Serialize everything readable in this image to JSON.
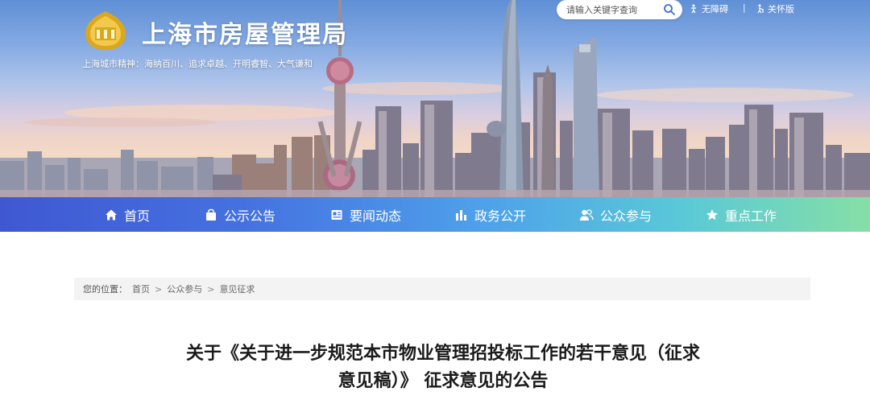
{
  "header": {
    "site_title": "上海市房屋管理局",
    "slogan": "上海城市精神：海纳百川、追求卓越、开明睿智、大气谦和",
    "logo_text": "Ⅲ"
  },
  "search": {
    "placeholder": "请输入关键字查询"
  },
  "top_links": {
    "accessibility": "无障碍",
    "elderly": "关怀版"
  },
  "nav": {
    "items": [
      {
        "label": "首页",
        "icon": "home-icon"
      },
      {
        "label": "公示公告",
        "icon": "bag-icon"
      },
      {
        "label": "要闻动态",
        "icon": "news-icon"
      },
      {
        "label": "政务公开",
        "icon": "bar-chart-icon"
      },
      {
        "label": "公众参与",
        "icon": "users-icon"
      },
      {
        "label": "重点工作",
        "icon": "star-icon"
      }
    ]
  },
  "breadcrumb": {
    "label": "您的位置：",
    "items": [
      "首页",
      "公众参与",
      "意见征求"
    ],
    "separator": ">"
  },
  "article": {
    "title_line1": "关于《关于进一步规范本市物业管理招投标工作的若干意见（征求",
    "title_line2": "意见稿）》 征求意见的公告"
  },
  "colors": {
    "nav_start": "#3f58d2",
    "nav_end": "#86dfa6",
    "logo_gold": "#d9a81e"
  }
}
